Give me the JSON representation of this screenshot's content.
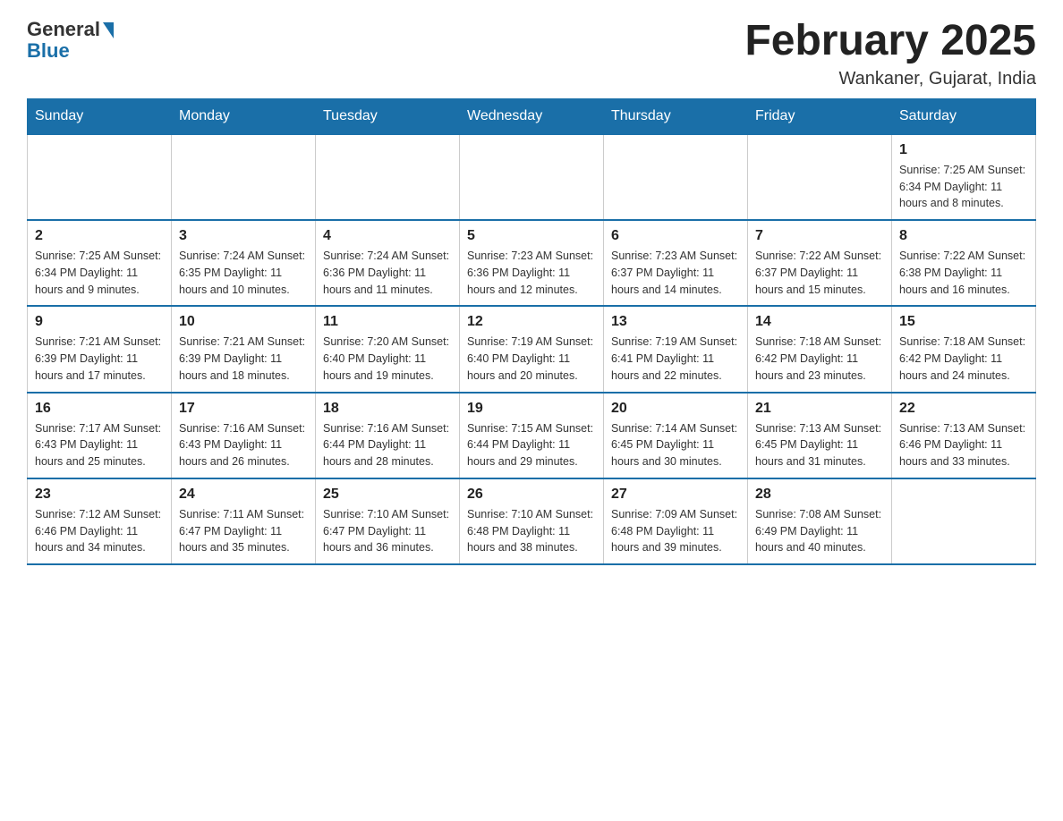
{
  "logo": {
    "general": "General",
    "blue": "Blue"
  },
  "header": {
    "title": "February 2025",
    "location": "Wankaner, Gujarat, India"
  },
  "days_of_week": [
    "Sunday",
    "Monday",
    "Tuesday",
    "Wednesday",
    "Thursday",
    "Friday",
    "Saturday"
  ],
  "weeks": [
    {
      "days": [
        {
          "date": "",
          "info": ""
        },
        {
          "date": "",
          "info": ""
        },
        {
          "date": "",
          "info": ""
        },
        {
          "date": "",
          "info": ""
        },
        {
          "date": "",
          "info": ""
        },
        {
          "date": "",
          "info": ""
        },
        {
          "date": "1",
          "info": "Sunrise: 7:25 AM\nSunset: 6:34 PM\nDaylight: 11 hours and 8 minutes."
        }
      ]
    },
    {
      "days": [
        {
          "date": "2",
          "info": "Sunrise: 7:25 AM\nSunset: 6:34 PM\nDaylight: 11 hours and 9 minutes."
        },
        {
          "date": "3",
          "info": "Sunrise: 7:24 AM\nSunset: 6:35 PM\nDaylight: 11 hours and 10 minutes."
        },
        {
          "date": "4",
          "info": "Sunrise: 7:24 AM\nSunset: 6:36 PM\nDaylight: 11 hours and 11 minutes."
        },
        {
          "date": "5",
          "info": "Sunrise: 7:23 AM\nSunset: 6:36 PM\nDaylight: 11 hours and 12 minutes."
        },
        {
          "date": "6",
          "info": "Sunrise: 7:23 AM\nSunset: 6:37 PM\nDaylight: 11 hours and 14 minutes."
        },
        {
          "date": "7",
          "info": "Sunrise: 7:22 AM\nSunset: 6:37 PM\nDaylight: 11 hours and 15 minutes."
        },
        {
          "date": "8",
          "info": "Sunrise: 7:22 AM\nSunset: 6:38 PM\nDaylight: 11 hours and 16 minutes."
        }
      ]
    },
    {
      "days": [
        {
          "date": "9",
          "info": "Sunrise: 7:21 AM\nSunset: 6:39 PM\nDaylight: 11 hours and 17 minutes."
        },
        {
          "date": "10",
          "info": "Sunrise: 7:21 AM\nSunset: 6:39 PM\nDaylight: 11 hours and 18 minutes."
        },
        {
          "date": "11",
          "info": "Sunrise: 7:20 AM\nSunset: 6:40 PM\nDaylight: 11 hours and 19 minutes."
        },
        {
          "date": "12",
          "info": "Sunrise: 7:19 AM\nSunset: 6:40 PM\nDaylight: 11 hours and 20 minutes."
        },
        {
          "date": "13",
          "info": "Sunrise: 7:19 AM\nSunset: 6:41 PM\nDaylight: 11 hours and 22 minutes."
        },
        {
          "date": "14",
          "info": "Sunrise: 7:18 AM\nSunset: 6:42 PM\nDaylight: 11 hours and 23 minutes."
        },
        {
          "date": "15",
          "info": "Sunrise: 7:18 AM\nSunset: 6:42 PM\nDaylight: 11 hours and 24 minutes."
        }
      ]
    },
    {
      "days": [
        {
          "date": "16",
          "info": "Sunrise: 7:17 AM\nSunset: 6:43 PM\nDaylight: 11 hours and 25 minutes."
        },
        {
          "date": "17",
          "info": "Sunrise: 7:16 AM\nSunset: 6:43 PM\nDaylight: 11 hours and 26 minutes."
        },
        {
          "date": "18",
          "info": "Sunrise: 7:16 AM\nSunset: 6:44 PM\nDaylight: 11 hours and 28 minutes."
        },
        {
          "date": "19",
          "info": "Sunrise: 7:15 AM\nSunset: 6:44 PM\nDaylight: 11 hours and 29 minutes."
        },
        {
          "date": "20",
          "info": "Sunrise: 7:14 AM\nSunset: 6:45 PM\nDaylight: 11 hours and 30 minutes."
        },
        {
          "date": "21",
          "info": "Sunrise: 7:13 AM\nSunset: 6:45 PM\nDaylight: 11 hours and 31 minutes."
        },
        {
          "date": "22",
          "info": "Sunrise: 7:13 AM\nSunset: 6:46 PM\nDaylight: 11 hours and 33 minutes."
        }
      ]
    },
    {
      "days": [
        {
          "date": "23",
          "info": "Sunrise: 7:12 AM\nSunset: 6:46 PM\nDaylight: 11 hours and 34 minutes."
        },
        {
          "date": "24",
          "info": "Sunrise: 7:11 AM\nSunset: 6:47 PM\nDaylight: 11 hours and 35 minutes."
        },
        {
          "date": "25",
          "info": "Sunrise: 7:10 AM\nSunset: 6:47 PM\nDaylight: 11 hours and 36 minutes."
        },
        {
          "date": "26",
          "info": "Sunrise: 7:10 AM\nSunset: 6:48 PM\nDaylight: 11 hours and 38 minutes."
        },
        {
          "date": "27",
          "info": "Sunrise: 7:09 AM\nSunset: 6:48 PM\nDaylight: 11 hours and 39 minutes."
        },
        {
          "date": "28",
          "info": "Sunrise: 7:08 AM\nSunset: 6:49 PM\nDaylight: 11 hours and 40 minutes."
        },
        {
          "date": "",
          "info": ""
        }
      ]
    }
  ]
}
